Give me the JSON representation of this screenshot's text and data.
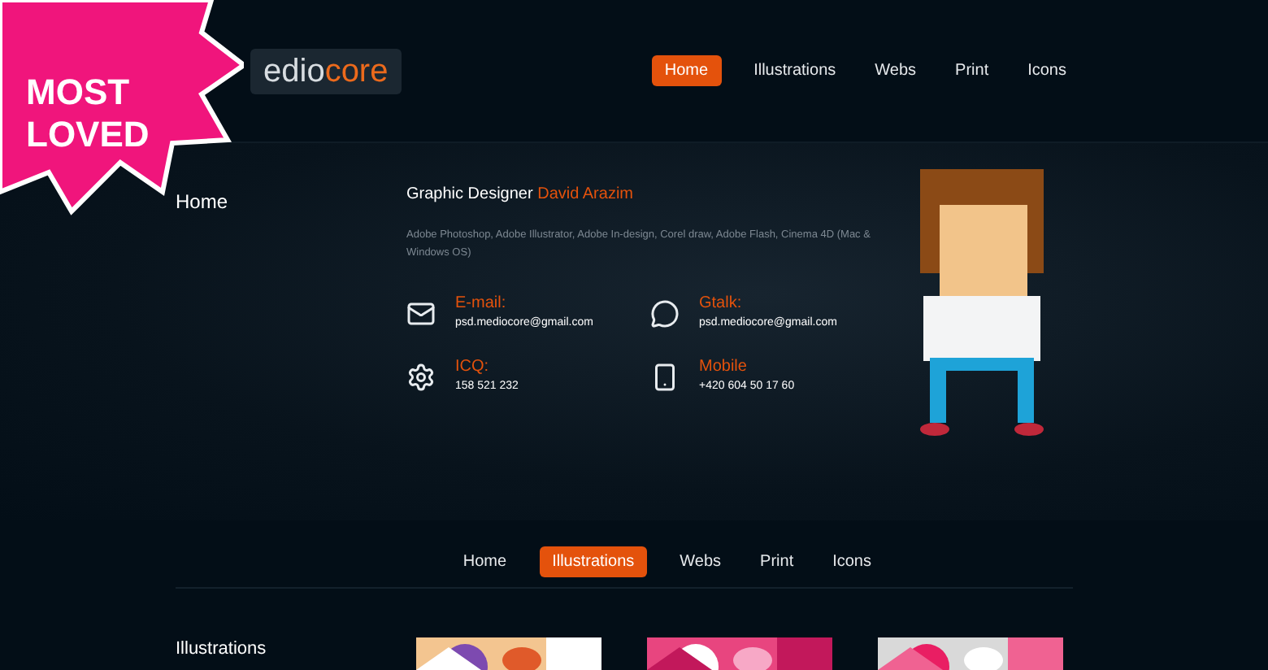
{
  "badge": "MOST LOVED",
  "logo": {
    "text": "edio",
    "accent": "core"
  },
  "top_nav": [
    {
      "label": "Home",
      "selected": true
    },
    {
      "label": "Illustrations",
      "selected": false
    },
    {
      "label": "Webs",
      "selected": false
    },
    {
      "label": "Print",
      "selected": false
    },
    {
      "label": "Icons",
      "selected": false
    }
  ],
  "hero": {
    "sidebar_title": "Home",
    "role": "Graphic Designer",
    "name": "David Arazim",
    "skills": "Adobe Photoshop, Adobe Illustrator, Adobe In-design, Corel draw, Adobe Flash, Cinema 4D (Mac & Windows OS)",
    "contacts": [
      {
        "kind": "email",
        "label": "E-mail:",
        "value": "psd.mediocore@gmail.com"
      },
      {
        "kind": "chat",
        "label": "Gtalk:",
        "value": "psd.mediocore@gmail.com"
      },
      {
        "kind": "gear",
        "label": "ICQ:",
        "value": "158 521 232"
      },
      {
        "kind": "phone",
        "label": "Mobile",
        "value": "+420 604 50 17 60"
      }
    ]
  },
  "section_nav": [
    {
      "label": "Home",
      "selected": false
    },
    {
      "label": "Illustrations",
      "selected": true
    },
    {
      "label": "Webs",
      "selected": false
    },
    {
      "label": "Print",
      "selected": false
    },
    {
      "label": "Icons",
      "selected": false
    }
  ],
  "section": {
    "title": "Illustrations"
  }
}
